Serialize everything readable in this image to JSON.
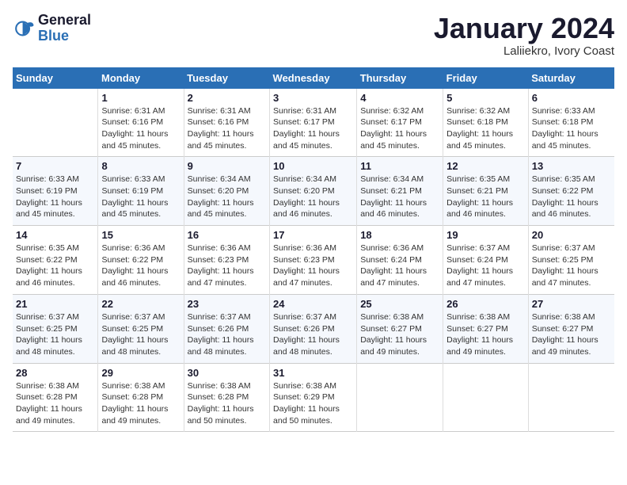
{
  "logo": {
    "line1": "General",
    "line2": "Blue"
  },
  "calendar": {
    "title": "January 2024",
    "subtitle": "Laliiekro, Ivory Coast"
  },
  "days_of_week": [
    "Sunday",
    "Monday",
    "Tuesday",
    "Wednesday",
    "Thursday",
    "Friday",
    "Saturday"
  ],
  "weeks": [
    [
      {
        "num": "",
        "empty": true
      },
      {
        "num": "1",
        "sunrise": "Sunrise: 6:31 AM",
        "sunset": "Sunset: 6:16 PM",
        "daylight": "Daylight: 11 hours and 45 minutes."
      },
      {
        "num": "2",
        "sunrise": "Sunrise: 6:31 AM",
        "sunset": "Sunset: 6:16 PM",
        "daylight": "Daylight: 11 hours and 45 minutes."
      },
      {
        "num": "3",
        "sunrise": "Sunrise: 6:31 AM",
        "sunset": "Sunset: 6:17 PM",
        "daylight": "Daylight: 11 hours and 45 minutes."
      },
      {
        "num": "4",
        "sunrise": "Sunrise: 6:32 AM",
        "sunset": "Sunset: 6:17 PM",
        "daylight": "Daylight: 11 hours and 45 minutes."
      },
      {
        "num": "5",
        "sunrise": "Sunrise: 6:32 AM",
        "sunset": "Sunset: 6:18 PM",
        "daylight": "Daylight: 11 hours and 45 minutes."
      },
      {
        "num": "6",
        "sunrise": "Sunrise: 6:33 AM",
        "sunset": "Sunset: 6:18 PM",
        "daylight": "Daylight: 11 hours and 45 minutes."
      }
    ],
    [
      {
        "num": "7",
        "sunrise": "Sunrise: 6:33 AM",
        "sunset": "Sunset: 6:19 PM",
        "daylight": "Daylight: 11 hours and 45 minutes."
      },
      {
        "num": "8",
        "sunrise": "Sunrise: 6:33 AM",
        "sunset": "Sunset: 6:19 PM",
        "daylight": "Daylight: 11 hours and 45 minutes."
      },
      {
        "num": "9",
        "sunrise": "Sunrise: 6:34 AM",
        "sunset": "Sunset: 6:20 PM",
        "daylight": "Daylight: 11 hours and 45 minutes."
      },
      {
        "num": "10",
        "sunrise": "Sunrise: 6:34 AM",
        "sunset": "Sunset: 6:20 PM",
        "daylight": "Daylight: 11 hours and 46 minutes."
      },
      {
        "num": "11",
        "sunrise": "Sunrise: 6:34 AM",
        "sunset": "Sunset: 6:21 PM",
        "daylight": "Daylight: 11 hours and 46 minutes."
      },
      {
        "num": "12",
        "sunrise": "Sunrise: 6:35 AM",
        "sunset": "Sunset: 6:21 PM",
        "daylight": "Daylight: 11 hours and 46 minutes."
      },
      {
        "num": "13",
        "sunrise": "Sunrise: 6:35 AM",
        "sunset": "Sunset: 6:22 PM",
        "daylight": "Daylight: 11 hours and 46 minutes."
      }
    ],
    [
      {
        "num": "14",
        "sunrise": "Sunrise: 6:35 AM",
        "sunset": "Sunset: 6:22 PM",
        "daylight": "Daylight: 11 hours and 46 minutes."
      },
      {
        "num": "15",
        "sunrise": "Sunrise: 6:36 AM",
        "sunset": "Sunset: 6:22 PM",
        "daylight": "Daylight: 11 hours and 46 minutes."
      },
      {
        "num": "16",
        "sunrise": "Sunrise: 6:36 AM",
        "sunset": "Sunset: 6:23 PM",
        "daylight": "Daylight: 11 hours and 47 minutes."
      },
      {
        "num": "17",
        "sunrise": "Sunrise: 6:36 AM",
        "sunset": "Sunset: 6:23 PM",
        "daylight": "Daylight: 11 hours and 47 minutes."
      },
      {
        "num": "18",
        "sunrise": "Sunrise: 6:36 AM",
        "sunset": "Sunset: 6:24 PM",
        "daylight": "Daylight: 11 hours and 47 minutes."
      },
      {
        "num": "19",
        "sunrise": "Sunrise: 6:37 AM",
        "sunset": "Sunset: 6:24 PM",
        "daylight": "Daylight: 11 hours and 47 minutes."
      },
      {
        "num": "20",
        "sunrise": "Sunrise: 6:37 AM",
        "sunset": "Sunset: 6:25 PM",
        "daylight": "Daylight: 11 hours and 47 minutes."
      }
    ],
    [
      {
        "num": "21",
        "sunrise": "Sunrise: 6:37 AM",
        "sunset": "Sunset: 6:25 PM",
        "daylight": "Daylight: 11 hours and 48 minutes."
      },
      {
        "num": "22",
        "sunrise": "Sunrise: 6:37 AM",
        "sunset": "Sunset: 6:25 PM",
        "daylight": "Daylight: 11 hours and 48 minutes."
      },
      {
        "num": "23",
        "sunrise": "Sunrise: 6:37 AM",
        "sunset": "Sunset: 6:26 PM",
        "daylight": "Daylight: 11 hours and 48 minutes."
      },
      {
        "num": "24",
        "sunrise": "Sunrise: 6:37 AM",
        "sunset": "Sunset: 6:26 PM",
        "daylight": "Daylight: 11 hours and 48 minutes."
      },
      {
        "num": "25",
        "sunrise": "Sunrise: 6:38 AM",
        "sunset": "Sunset: 6:27 PM",
        "daylight": "Daylight: 11 hours and 49 minutes."
      },
      {
        "num": "26",
        "sunrise": "Sunrise: 6:38 AM",
        "sunset": "Sunset: 6:27 PM",
        "daylight": "Daylight: 11 hours and 49 minutes."
      },
      {
        "num": "27",
        "sunrise": "Sunrise: 6:38 AM",
        "sunset": "Sunset: 6:27 PM",
        "daylight": "Daylight: 11 hours and 49 minutes."
      }
    ],
    [
      {
        "num": "28",
        "sunrise": "Sunrise: 6:38 AM",
        "sunset": "Sunset: 6:28 PM",
        "daylight": "Daylight: 11 hours and 49 minutes."
      },
      {
        "num": "29",
        "sunrise": "Sunrise: 6:38 AM",
        "sunset": "Sunset: 6:28 PM",
        "daylight": "Daylight: 11 hours and 49 minutes."
      },
      {
        "num": "30",
        "sunrise": "Sunrise: 6:38 AM",
        "sunset": "Sunset: 6:28 PM",
        "daylight": "Daylight: 11 hours and 50 minutes."
      },
      {
        "num": "31",
        "sunrise": "Sunrise: 6:38 AM",
        "sunset": "Sunset: 6:29 PM",
        "daylight": "Daylight: 11 hours and 50 minutes."
      },
      {
        "num": "",
        "empty": true
      },
      {
        "num": "",
        "empty": true
      },
      {
        "num": "",
        "empty": true
      }
    ]
  ]
}
